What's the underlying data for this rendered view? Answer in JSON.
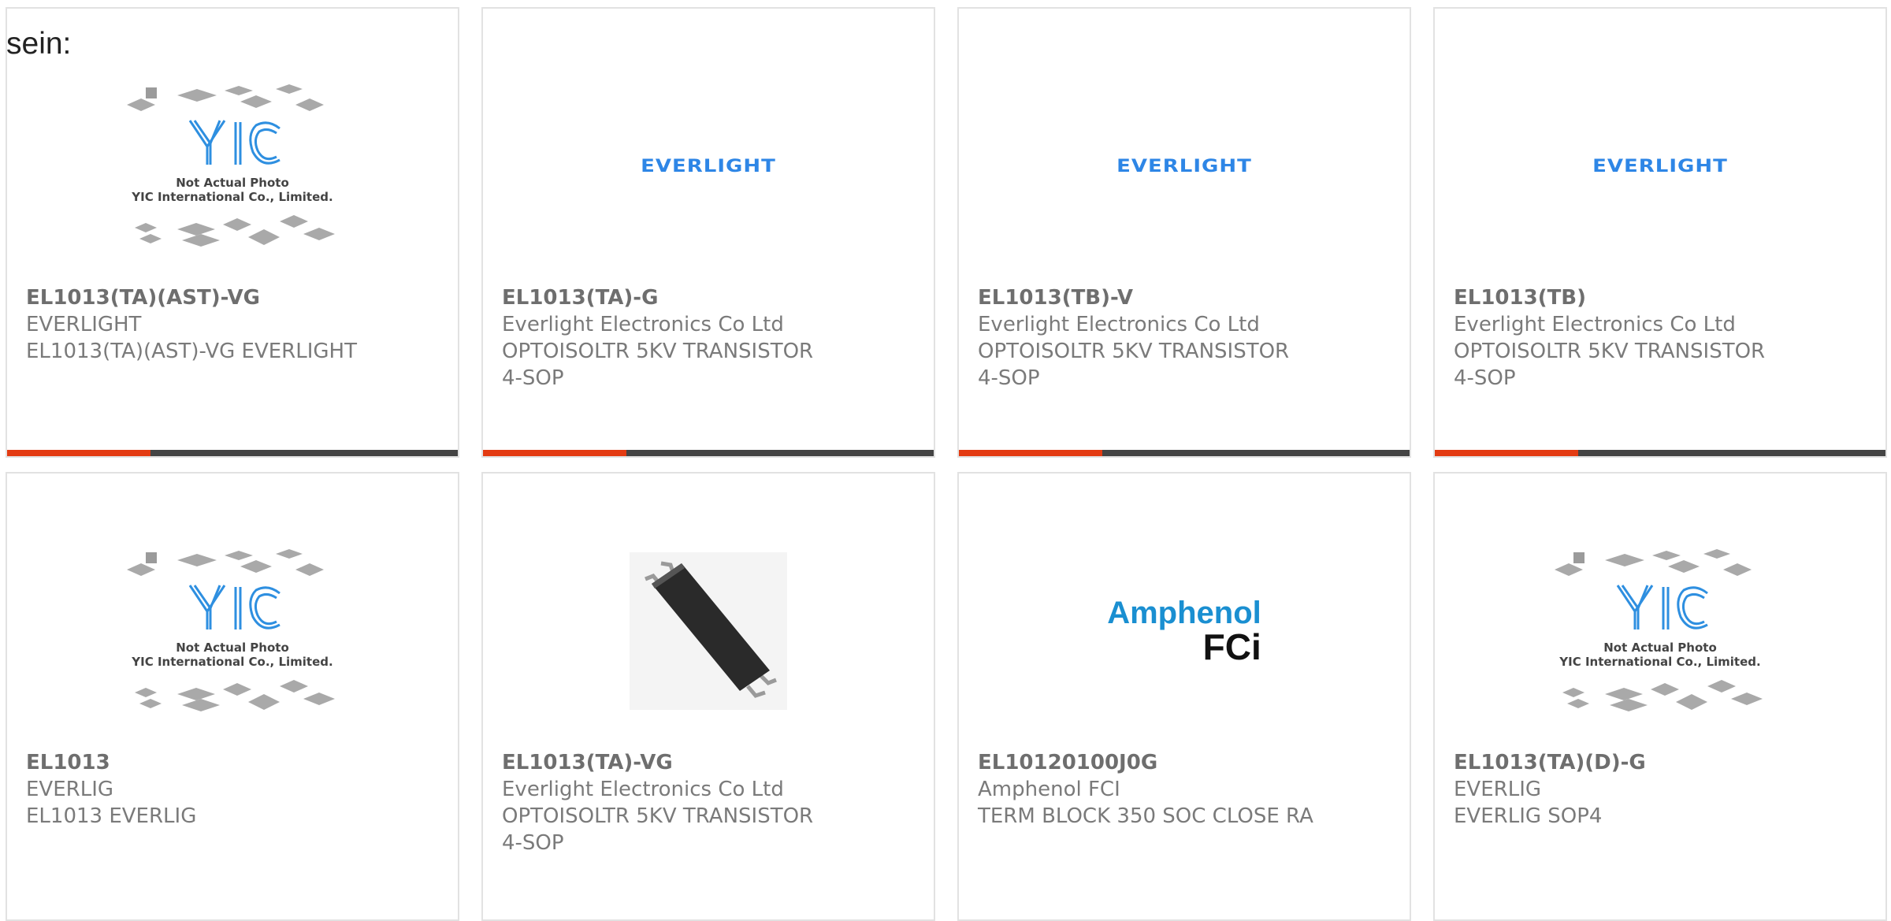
{
  "page": {
    "heading": "sein:"
  },
  "colors": {
    "accent": "#e33b12",
    "bar": "#444444",
    "everlight_blue": "#2e86e6",
    "amphenol_blue": "#1a8fd1"
  },
  "yic": {
    "line1": "Not Actual Photo",
    "line2": "YIC International Co., Limited."
  },
  "logos": {
    "everlight": "EVERLIGHT",
    "amphenol_top": "Amphenol",
    "amphenol_bottom": "FCi"
  },
  "products": [
    {
      "part": "EL1013(TA)(AST)-VG",
      "manufacturer": "EVERLIGHT",
      "desc1": "EL1013(TA)(AST)-VG EVERLIGHT",
      "desc2": "",
      "image": "yic-placeholder"
    },
    {
      "part": "EL1013(TA)-G",
      "manufacturer": "Everlight Electronics Co Ltd",
      "desc1": "OPTOISOLTR 5KV TRANSISTOR",
      "desc2": "4-SOP",
      "image": "everlight-logo"
    },
    {
      "part": "EL1013(TB)-V",
      "manufacturer": "Everlight Electronics Co Ltd",
      "desc1": "OPTOISOLTR 5KV TRANSISTOR",
      "desc2": "4-SOP",
      "image": "everlight-logo"
    },
    {
      "part": "EL1013(TB)",
      "manufacturer": "Everlight Electronics Co Ltd",
      "desc1": "OPTOISOLTR 5KV TRANSISTOR",
      "desc2": "4-SOP",
      "image": "everlight-logo"
    },
    {
      "part": "EL1013",
      "manufacturer": "EVERLIG",
      "desc1": "EL1013 EVERLIG",
      "desc2": "",
      "image": "yic-placeholder"
    },
    {
      "part": "EL1013(TA)-VG",
      "manufacturer": "Everlight Electronics Co Ltd",
      "desc1": "OPTOISOLTR 5KV TRANSISTOR",
      "desc2": "4-SOP",
      "image": "ic-chip-photo"
    },
    {
      "part": "EL10120100J0G",
      "manufacturer": "Amphenol FCI",
      "desc1": "TERM BLOCK 350 SOC CLOSE RA",
      "desc2": "",
      "image": "amphenol-logo"
    },
    {
      "part": "EL1013(TA)(D)-G",
      "manufacturer": "EVERLIG",
      "desc1": "EVERLIG SOP4",
      "desc2": "",
      "image": "yic-placeholder"
    }
  ]
}
